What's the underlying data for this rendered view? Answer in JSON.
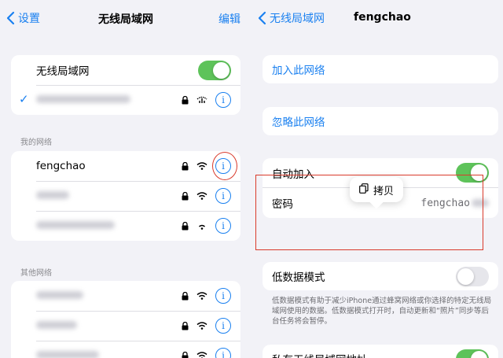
{
  "left": {
    "nav": {
      "back_label": "设置",
      "title": "无线局域网",
      "edit_label": "编辑"
    },
    "wifi_toggle": {
      "label": "无线局域网",
      "on": true
    },
    "my_networks_header": "我的网络",
    "my_networks": [
      {
        "name": "fengchao",
        "locked": true
      },
      {
        "name": "",
        "locked": true
      },
      {
        "name": "",
        "locked": true
      }
    ],
    "other_networks_header": "其他网络"
  },
  "right": {
    "nav": {
      "back_label": "无线局域网",
      "title": "fengchao"
    },
    "join_label": "加入此网络",
    "forget_label": "忽略此网络",
    "auto_join": {
      "label": "自动加入",
      "on": true
    },
    "copy_popup_label": "拷贝",
    "password": {
      "label": "密码",
      "value": "fengchao"
    },
    "low_data": {
      "label": "低数据模式",
      "on": false
    },
    "low_data_note": "低数据模式有助于减少iPhone通过蜂窝网络或你选择的特定无线局域网使用的数据。低数据模式打开时，自动更新和“照片”同步等后台任务将会暂停。",
    "private_address": {
      "label": "私有无线局域网地址",
      "on": true
    }
  },
  "colors": {
    "accent": "#1a80f0",
    "toggle_on": "#5ec35a",
    "annotation": "#d93a2b"
  },
  "icons": [
    "chevron-left-icon",
    "lock-icon",
    "wifi-icon",
    "info-icon",
    "checkmark-icon",
    "copy-icon"
  ]
}
